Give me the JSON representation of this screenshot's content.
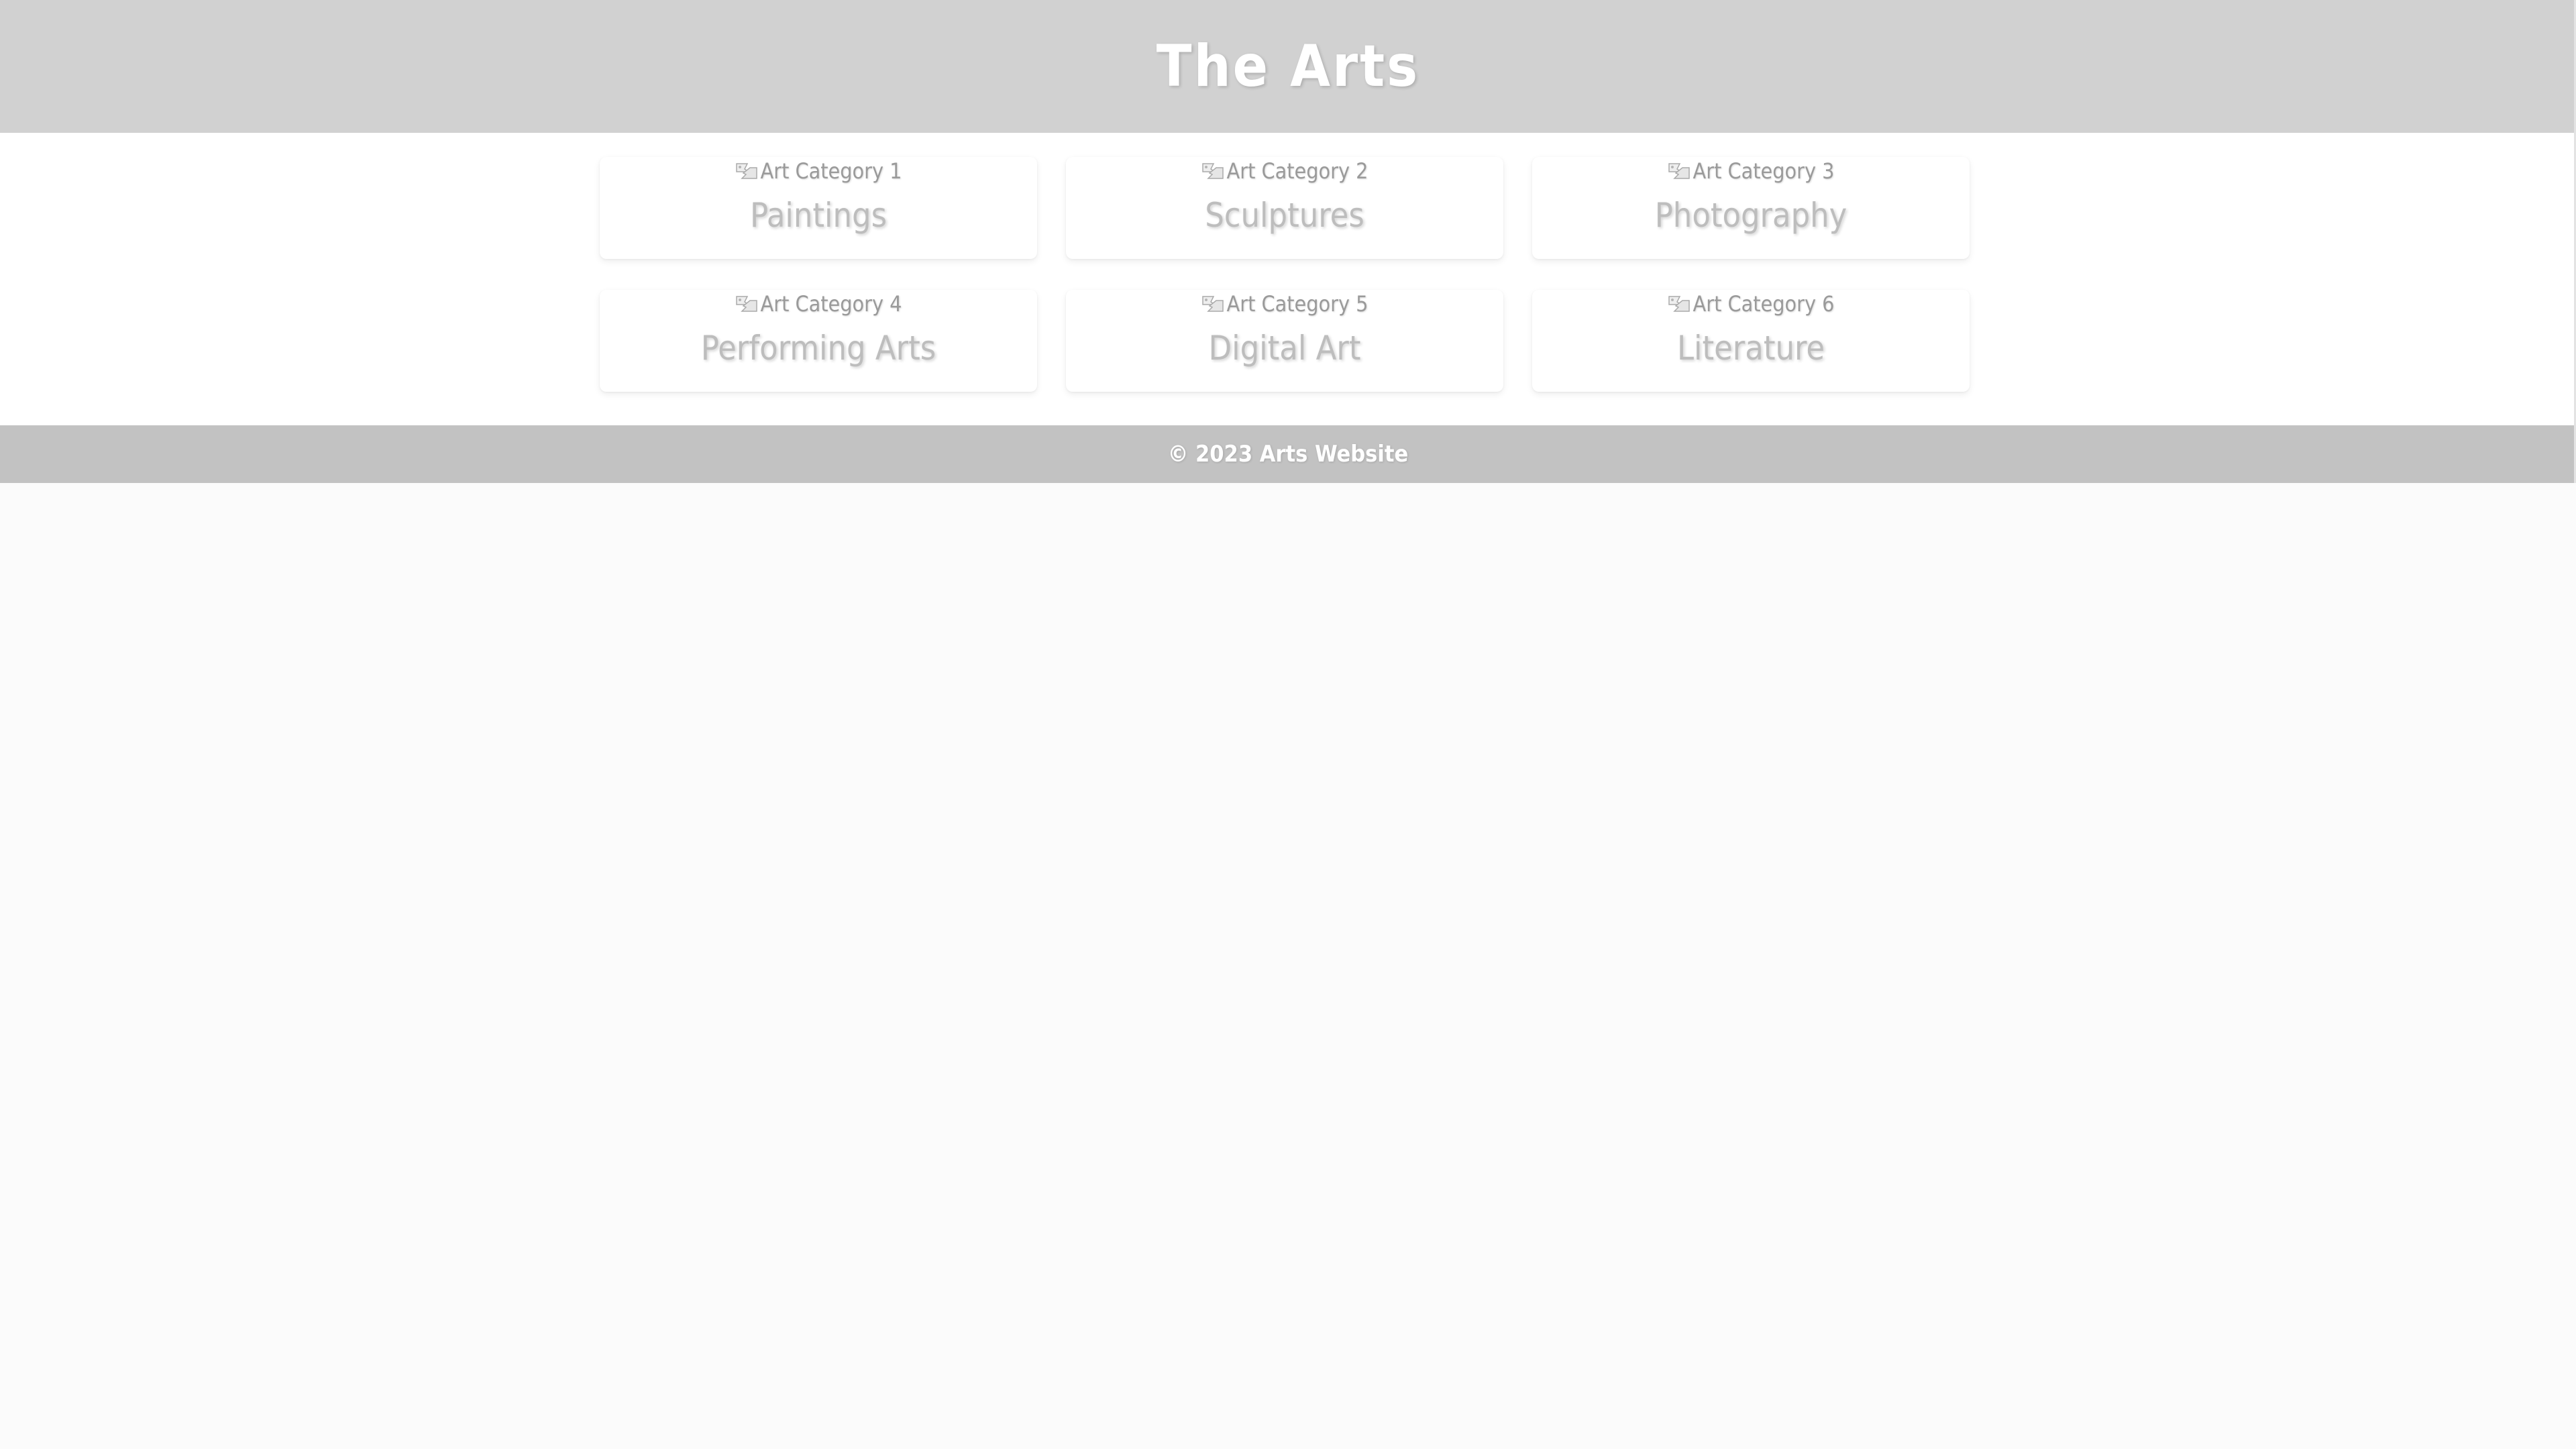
{
  "header": {
    "title": "The Arts"
  },
  "categories": [
    {
      "image_alt": "Art Category 1",
      "label": "Paintings"
    },
    {
      "image_alt": "Art Category 2",
      "label": "Sculptures"
    },
    {
      "image_alt": "Art Category 3",
      "label": "Photography"
    },
    {
      "image_alt": "Art Category 4",
      "label": "Performing Arts"
    },
    {
      "image_alt": "Art Category 5",
      "label": "Digital Art"
    },
    {
      "image_alt": "Art Category 6",
      "label": "Literature"
    }
  ],
  "footer": {
    "copyright": "© 2023 Arts Website"
  },
  "colors": {
    "header_bg": "#d1d1d1",
    "footer_bg": "#c2c2c2",
    "page_bg": "#fbfbfb"
  },
  "icons": {
    "image_placeholder": "broken-image-icon"
  }
}
